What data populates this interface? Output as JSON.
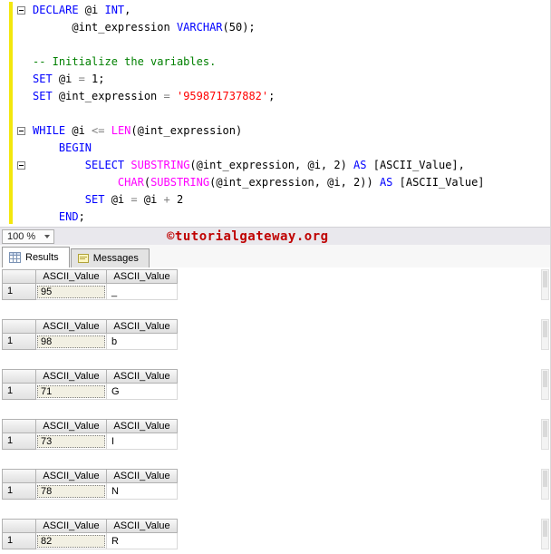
{
  "editor": {
    "zoom_label": "100 %",
    "lines": [
      {
        "fold": true,
        "segments": [
          {
            "c": "kw",
            "t": "DECLARE"
          },
          {
            "c": "pl",
            "t": " @i "
          },
          {
            "c": "kw",
            "t": "INT"
          },
          {
            "c": "pl",
            "t": ","
          }
        ]
      },
      {
        "fold": false,
        "segments": [
          {
            "c": "pl",
            "t": "      @int_expression "
          },
          {
            "c": "kw",
            "t": "VARCHAR"
          },
          {
            "c": "pl",
            "t": "(50);"
          }
        ]
      },
      {
        "fold": false,
        "segments": []
      },
      {
        "fold": false,
        "segments": [
          {
            "c": "cm",
            "t": "-- Initialize the variables."
          }
        ]
      },
      {
        "fold": false,
        "segments": [
          {
            "c": "kw",
            "t": "SET"
          },
          {
            "c": "pl",
            "t": " @i "
          },
          {
            "c": "op",
            "t": "="
          },
          {
            "c": "pl",
            "t": " 1;"
          }
        ]
      },
      {
        "fold": false,
        "segments": [
          {
            "c": "kw",
            "t": "SET"
          },
          {
            "c": "pl",
            "t": " @int_expression "
          },
          {
            "c": "op",
            "t": "="
          },
          {
            "c": "pl",
            "t": " "
          },
          {
            "c": "str",
            "t": "'959871737882'"
          },
          {
            "c": "pl",
            "t": ";"
          }
        ]
      },
      {
        "fold": false,
        "segments": []
      },
      {
        "fold": true,
        "segments": [
          {
            "c": "kw",
            "t": "WHILE"
          },
          {
            "c": "pl",
            "t": " @i "
          },
          {
            "c": "op",
            "t": "<="
          },
          {
            "c": "pl",
            "t": " "
          },
          {
            "c": "fn",
            "t": "LEN"
          },
          {
            "c": "pl",
            "t": "(@int_expression)"
          }
        ]
      },
      {
        "fold": false,
        "segments": [
          {
            "c": "pl",
            "t": "    "
          },
          {
            "c": "kw",
            "t": "BEGIN"
          }
        ]
      },
      {
        "fold": true,
        "segments": [
          {
            "c": "pl",
            "t": "        "
          },
          {
            "c": "kw",
            "t": "SELECT"
          },
          {
            "c": "pl",
            "t": " "
          },
          {
            "c": "fn",
            "t": "SUBSTRING"
          },
          {
            "c": "pl",
            "t": "(@int_expression, @i, 2) "
          },
          {
            "c": "kw",
            "t": "AS"
          },
          {
            "c": "pl",
            "t": " [ASCII_Value],"
          }
        ]
      },
      {
        "fold": false,
        "segments": [
          {
            "c": "pl",
            "t": "             "
          },
          {
            "c": "fn",
            "t": "CHAR"
          },
          {
            "c": "pl",
            "t": "("
          },
          {
            "c": "fn",
            "t": "SUBSTRING"
          },
          {
            "c": "pl",
            "t": "(@int_expression, @i, 2)) "
          },
          {
            "c": "kw",
            "t": "AS"
          },
          {
            "c": "pl",
            "t": " [ASCII_Value]"
          }
        ]
      },
      {
        "fold": false,
        "segments": [
          {
            "c": "pl",
            "t": "        "
          },
          {
            "c": "kw",
            "t": "SET"
          },
          {
            "c": "pl",
            "t": " @i "
          },
          {
            "c": "op",
            "t": "="
          },
          {
            "c": "pl",
            "t": " @i "
          },
          {
            "c": "op",
            "t": "+"
          },
          {
            "c": "pl",
            "t": " 2"
          }
        ]
      },
      {
        "fold": false,
        "segments": [
          {
            "c": "pl",
            "t": "    "
          },
          {
            "c": "kw",
            "t": "END"
          },
          {
            "c": "pl",
            "t": ";"
          }
        ]
      }
    ]
  },
  "watermark": "©tutorialgateway.org",
  "tabs": [
    {
      "label": "Results",
      "icon": "results-grid-icon",
      "active": true
    },
    {
      "label": "Messages",
      "icon": "messages-icon",
      "active": false
    }
  ],
  "results": {
    "grids": [
      {
        "row_num": "1",
        "columns": [
          "ASCII_Value",
          "ASCII_Value"
        ],
        "values": [
          "95",
          "_"
        ]
      },
      {
        "row_num": "1",
        "columns": [
          "ASCII_Value",
          "ASCII_Value"
        ],
        "values": [
          "98",
          "b"
        ]
      },
      {
        "row_num": "1",
        "columns": [
          "ASCII_Value",
          "ASCII_Value"
        ],
        "values": [
          "71",
          "G"
        ]
      },
      {
        "row_num": "1",
        "columns": [
          "ASCII_Value",
          "ASCII_Value"
        ],
        "values": [
          "73",
          "I"
        ]
      },
      {
        "row_num": "1",
        "columns": [
          "ASCII_Value",
          "ASCII_Value"
        ],
        "values": [
          "78",
          "N"
        ]
      },
      {
        "row_num": "1",
        "columns": [
          "ASCII_Value",
          "ASCII_Value"
        ],
        "values": [
          "82",
          "R"
        ]
      }
    ]
  },
  "colors": {
    "keyword": "#0000ff",
    "function": "#ff00ff",
    "comment": "#008000",
    "string": "#ff0000",
    "operator": "#808080",
    "watermark": "#bf0000",
    "trackbar": "#f3e70d"
  }
}
